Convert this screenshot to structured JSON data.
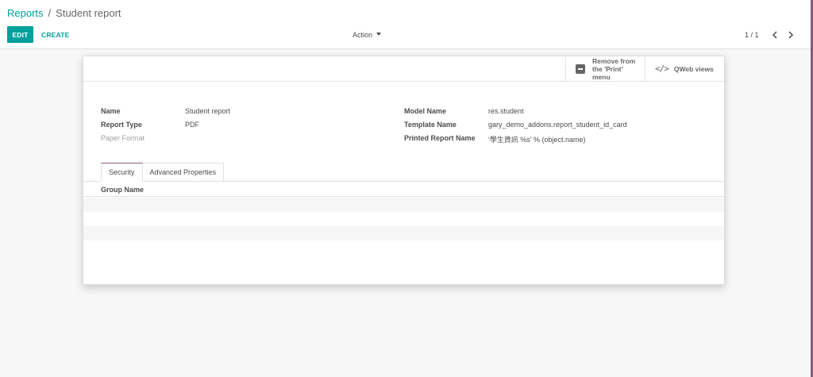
{
  "breadcrumb": {
    "parent": "Reports",
    "separator": "/",
    "current": "Student report"
  },
  "toolbar": {
    "edit_label": "EDIT",
    "create_label": "CREATE",
    "action_label": "Action"
  },
  "pager": {
    "value": "1 / 1"
  },
  "smart_buttons": {
    "remove_label": "Remove from the 'Print' menu",
    "qweb_label": "QWeb views",
    "qweb_icon": "</>"
  },
  "fields": {
    "name_label": "Name",
    "name_value": "Student report",
    "report_type_label": "Report Type",
    "report_type_value": "PDF",
    "paper_format_label": "Paper Format",
    "model_name_label": "Model Name",
    "model_name_value": "res.student",
    "template_name_label": "Template Name",
    "template_name_value": "gary_demo_addons.report_student_id_card",
    "printed_name_label": "Printed Report Name",
    "printed_name_value": "'學生資訊 %s' % (object.name)"
  },
  "tabs": {
    "security": "Security",
    "advanced": "Advanced Properties"
  },
  "table": {
    "group_name_header": "Group Name"
  },
  "colors": {
    "accent": "#00a09d",
    "brand": "#875a7b"
  }
}
